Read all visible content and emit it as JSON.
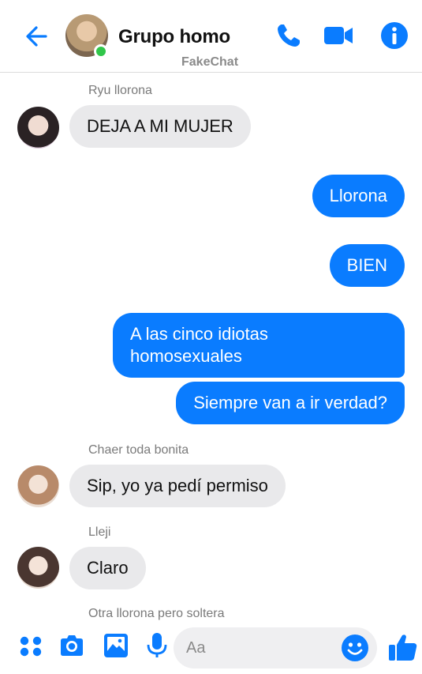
{
  "header": {
    "title": "Grupo homo",
    "watermark": "FakeChat",
    "accent": "#0a7cff"
  },
  "messages": [
    {
      "sender": "Ryu llorona",
      "text": "DEJA A MI MUJER",
      "direction": "in"
    },
    {
      "text": "Llorona",
      "direction": "out"
    },
    {
      "text": "BIEN",
      "direction": "out"
    },
    {
      "text": "A las cinco idiotas homosexuales",
      "line1": "A las cinco idiotas",
      "line2": "homosexuales",
      "direction": "out"
    },
    {
      "text": "Siempre van a ir verdad?",
      "direction": "out"
    },
    {
      "sender": "Chaer toda bonita",
      "text": "Sip, yo ya pedí permiso",
      "direction": "in"
    },
    {
      "sender": "Lleji",
      "text": "Claro",
      "direction": "in"
    },
    {
      "sender": "Otra llorona pero soltera",
      "direction": "in"
    }
  ],
  "composer": {
    "placeholder": "Aa"
  },
  "icons": {
    "back": "back-arrow-icon",
    "call": "phone-icon",
    "video": "video-camera-icon",
    "info": "info-icon",
    "apps": "apps-grid-icon",
    "camera": "camera-icon",
    "gallery": "image-icon",
    "mic": "microphone-icon",
    "emoji": "emoji-icon",
    "like": "thumbs-up-icon"
  }
}
